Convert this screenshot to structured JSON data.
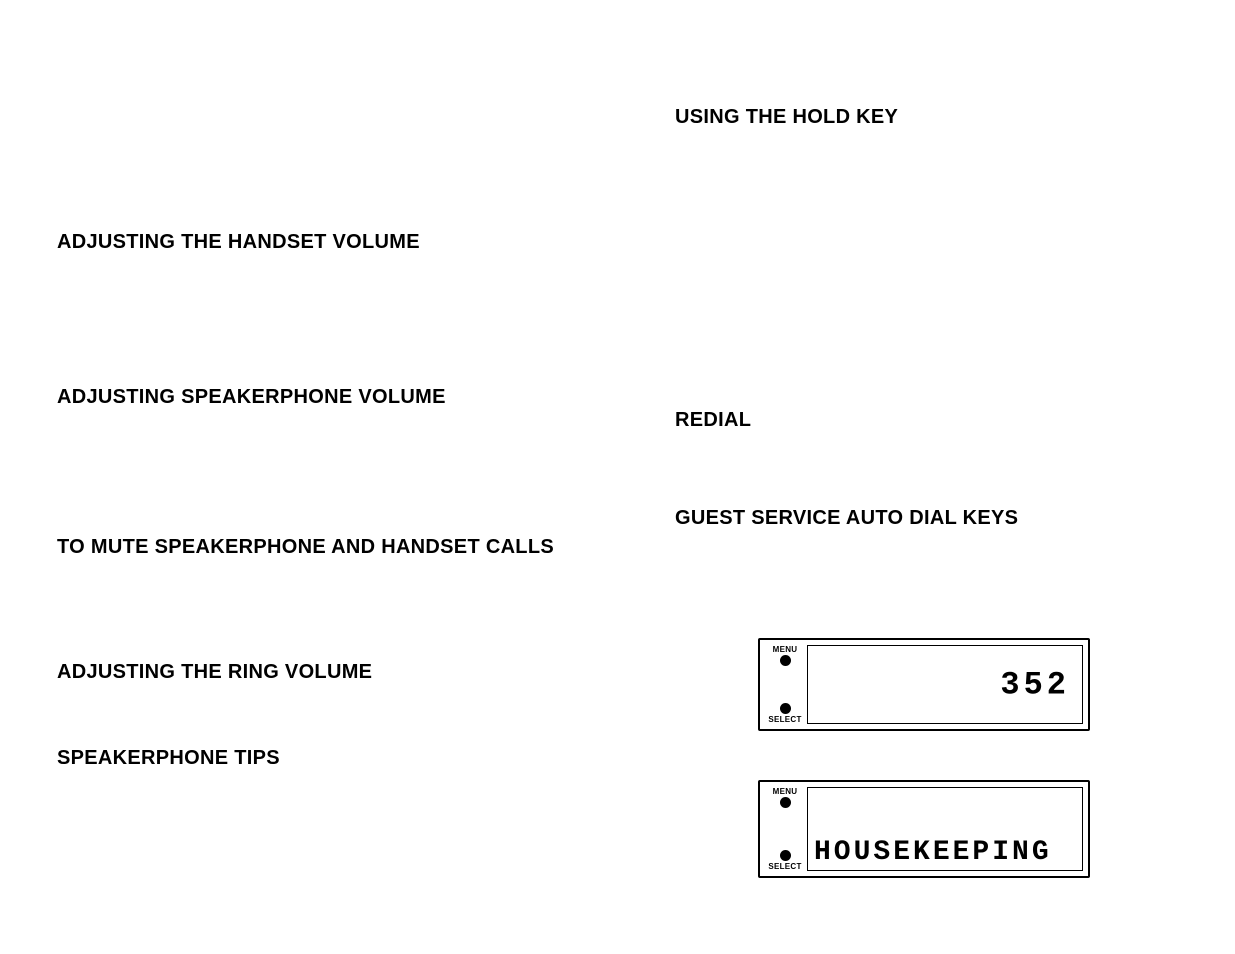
{
  "left_column": {
    "heading1": "ADJUSTING THE HANDSET VOLUME",
    "heading2": "ADJUSTING SPEAKERPHONE VOLUME",
    "heading3": "TO MUTE SPEAKERPHONE AND HANDSET CALLS",
    "heading4": "ADJUSTING THE RING VOLUME",
    "heading5": "SPEAKERPHONE TIPS"
  },
  "right_column": {
    "heading1": "USING THE HOLD KEY",
    "heading2": "REDIAL",
    "heading3": "GUEST SERVICE AUTO DIAL KEYS"
  },
  "lcd": {
    "menu_label": "MENU",
    "select_label": "SELECT",
    "panel1_value": "352",
    "panel2_value": "HOUSEKEEPING"
  }
}
